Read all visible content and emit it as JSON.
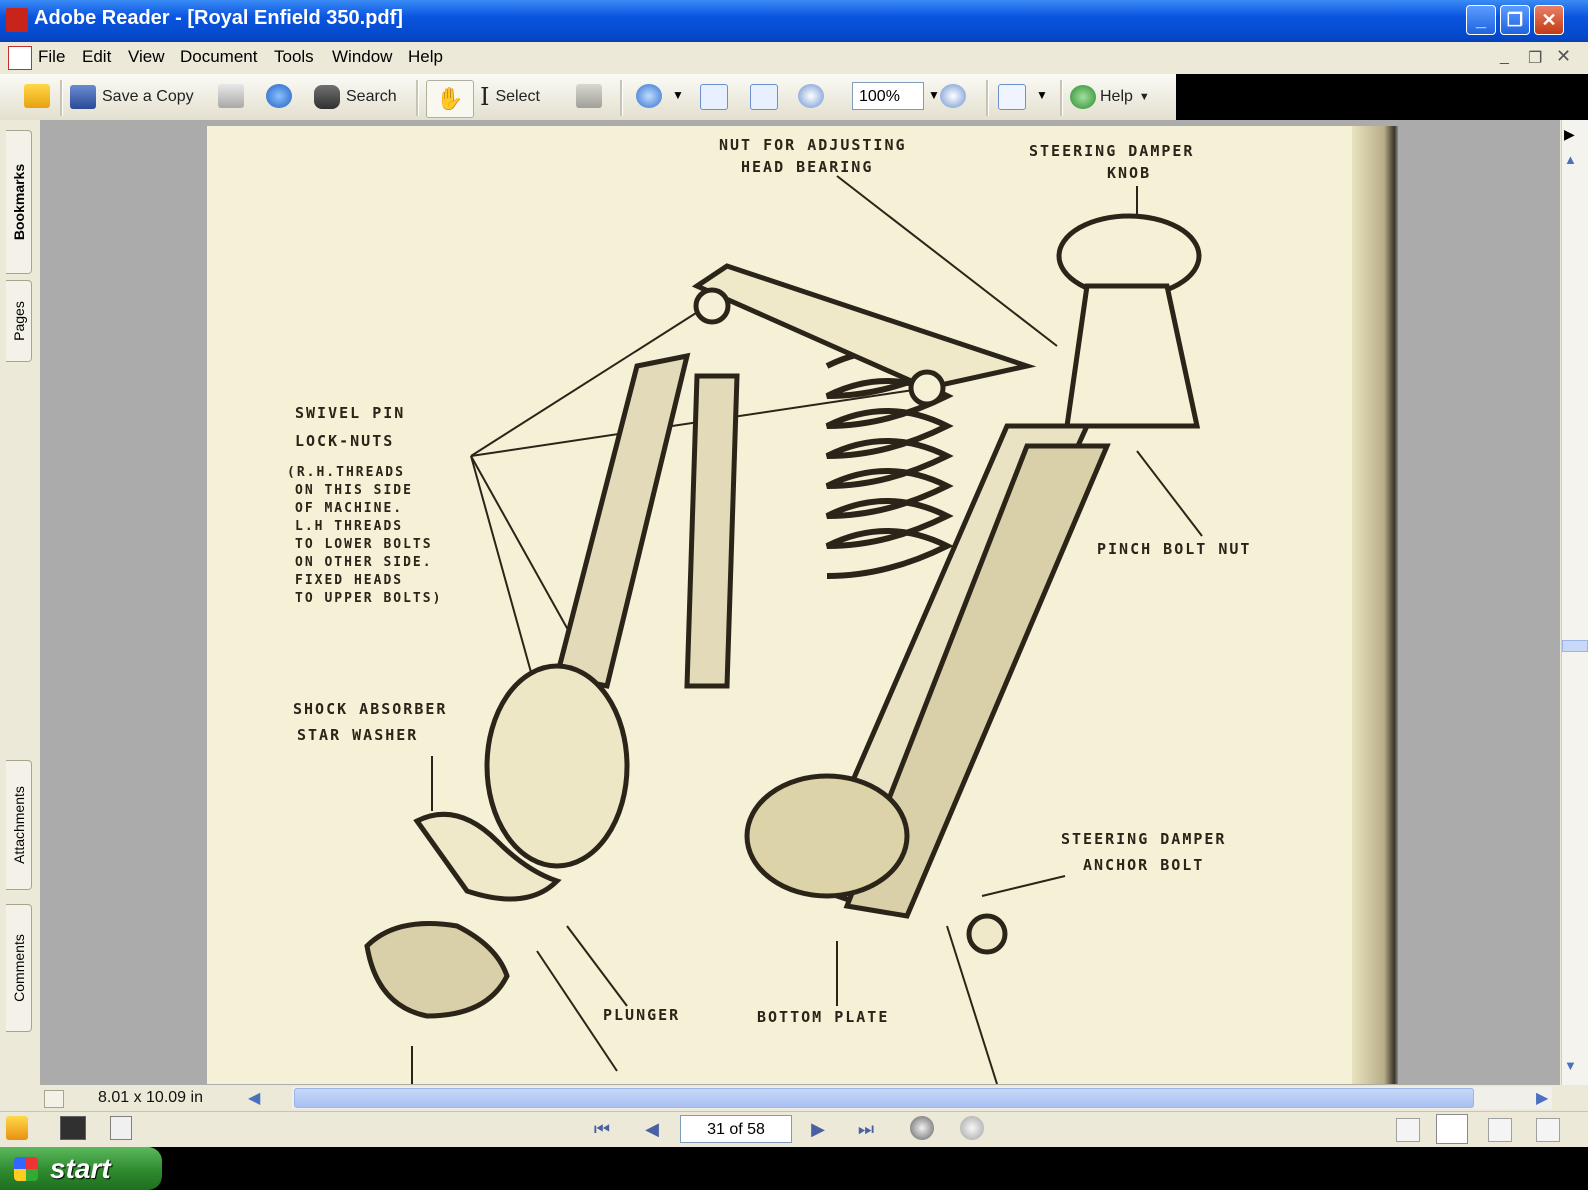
{
  "window": {
    "title": "Adobe Reader - [Royal Enfield 350.pdf]",
    "minimize": "_",
    "restore": "❐",
    "close": "✕"
  },
  "menu": [
    "File",
    "Edit",
    "View",
    "Document",
    "Tools",
    "Window",
    "Help"
  ],
  "toolbar": {
    "save_copy": "Save a Copy",
    "search": "Search",
    "select": "Select",
    "zoom": "100%",
    "help": "Help"
  },
  "side_tabs": [
    "Bookmarks",
    "Pages",
    "Attachments",
    "Comments"
  ],
  "diagram": {
    "nut_adjusting": [
      "NUT FOR ADJUSTING",
      "HEAD BEARING"
    ],
    "steering_damper_knob": [
      "STEERING DAMPER",
      "KNOB"
    ],
    "swivel_pin": [
      "SWIVEL PIN",
      "LOCK-NUTS"
    ],
    "threads_note": [
      "(R.H.THREADS",
      "ON THIS SIDE",
      "OF MACHINE.",
      "L.H THREADS",
      "TO LOWER BOLTS",
      "ON OTHER SIDE.",
      "FIXED HEADS",
      "TO UPPER BOLTS)"
    ],
    "pinch_bolt": "PINCH BOLT NUT",
    "shock_absorber": [
      "SHOCK ABSORBER",
      "STAR WASHER"
    ],
    "anchor_bolt": [
      "STEERING DAMPER",
      "ANCHOR BOLT"
    ],
    "plunger": "PLUNGER",
    "bottom_plate": "BOTTOM PLATE"
  },
  "status": {
    "page_size": "8.01 x 10.09 in",
    "page_nav": "31 of 58"
  },
  "taskbar": {
    "start": "start"
  },
  "colors": {
    "titlebar": "#0a54e0",
    "page": "#f4f1d6",
    "ink": "#2b2418"
  }
}
